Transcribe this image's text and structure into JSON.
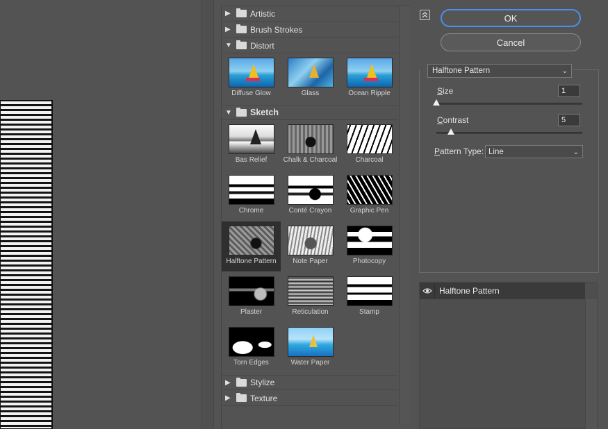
{
  "gallery": {
    "categories": [
      {
        "label": "Artistic",
        "expanded": false
      },
      {
        "label": "Brush Strokes",
        "expanded": false
      },
      {
        "label": "Distort",
        "expanded": true
      },
      {
        "label": "Sketch",
        "expanded": true
      },
      {
        "label": "Stylize",
        "expanded": false
      },
      {
        "label": "Texture",
        "expanded": false
      }
    ],
    "distort_filters": [
      "Diffuse Glow",
      "Glass",
      "Ocean Ripple"
    ],
    "sketch_filters": [
      "Bas Relief",
      "Chalk & Charcoal",
      "Charcoal",
      "Chrome",
      "Conté Crayon",
      "Graphic Pen",
      "Halftone Pattern",
      "Note Paper",
      "Photocopy",
      "Plaster",
      "Reticulation",
      "Stamp",
      "Torn Edges",
      "Water Paper"
    ],
    "selected_filter": "Halftone Pattern"
  },
  "buttons": {
    "ok": "OK",
    "cancel": "Cancel"
  },
  "settings": {
    "filter_name": "Halftone Pattern",
    "size_label_accel": "S",
    "size_label_rest": "ize",
    "size_value": "1",
    "size_fraction": 0.0,
    "contrast_label_accel": "C",
    "contrast_label_rest": "ontrast",
    "contrast_value": "5",
    "contrast_fraction": 0.1,
    "pattern_label_accel": "P",
    "pattern_label_rest": "attern Type:",
    "pattern_value": "Line"
  },
  "layers": {
    "items": [
      {
        "label": "Halftone Pattern",
        "visible": true
      }
    ]
  },
  "icons": {
    "collapse": "collapse-panel-icon",
    "eye": "eye-icon",
    "folder": "folder-icon",
    "chevron": "chevron-down-icon"
  },
  "colors": {
    "accent": "#4a8ff0",
    "background": "#535353",
    "selected": "#2f2f2f"
  }
}
